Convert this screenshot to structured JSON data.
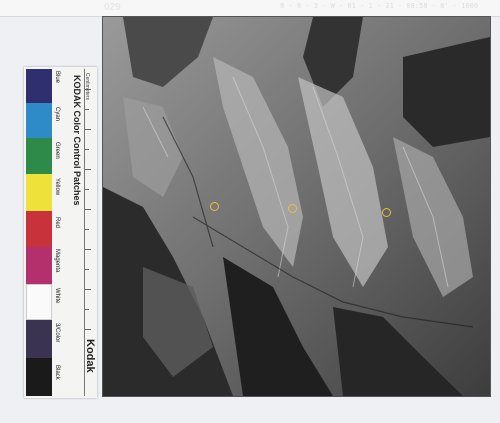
{
  "photo": {
    "frame_number": "029",
    "header_codes": "8 · 8 · 3 · W · 61 · 1 · 21 · 08:58 · 8' · 1600",
    "markers_color": "#e6c23a"
  },
  "card": {
    "brand_title": "KODAK Color Control Patches",
    "logo": "Kodak",
    "centimeters": "Centimeters",
    "inches": "Inches",
    "patches": [
      {
        "name": "Blue",
        "color": "#2f2e6e"
      },
      {
        "name": "Cyan",
        "color": "#2f8ac8"
      },
      {
        "name": "Green",
        "color": "#2e8a48"
      },
      {
        "name": "Yellow",
        "color": "#ece23a"
      },
      {
        "name": "Red",
        "color": "#c8323a"
      },
      {
        "name": "Magenta",
        "color": "#b4306c"
      },
      {
        "name": "White",
        "color": "#fafafa"
      },
      {
        "name": "3/Color",
        "color": "#3a3450"
      },
      {
        "name": "Black",
        "color": "#1a1a1a"
      }
    ]
  }
}
